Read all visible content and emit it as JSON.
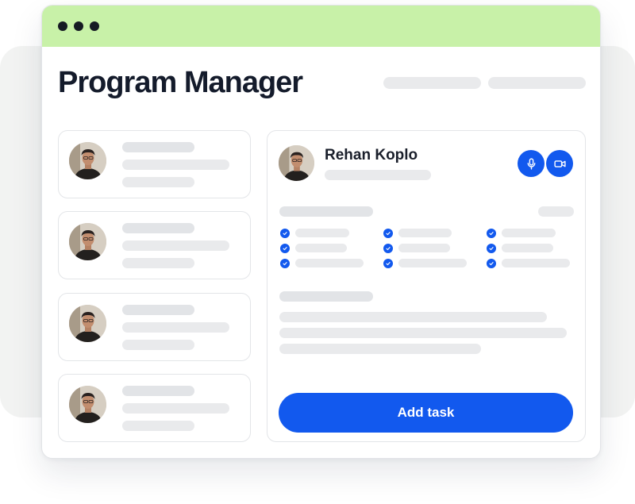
{
  "app": {
    "title": "Program Manager"
  },
  "list": {
    "items": [
      {
        "avatar": "person-avatar"
      },
      {
        "avatar": "person-avatar"
      },
      {
        "avatar": "person-avatar"
      },
      {
        "avatar": "person-avatar"
      }
    ]
  },
  "detail": {
    "name": "Rehan Koplo",
    "actions": {
      "microphone_icon": "microphone-icon",
      "video_icon": "video-camera-icon"
    },
    "checklist_icon": "checkmark-icon",
    "primary_button_label": "Add task"
  },
  "colors": {
    "accent": "#1259ee",
    "titlebar": "#c8f1a8",
    "placeholder": "#e9eaec",
    "title_text": "#141b2b"
  }
}
